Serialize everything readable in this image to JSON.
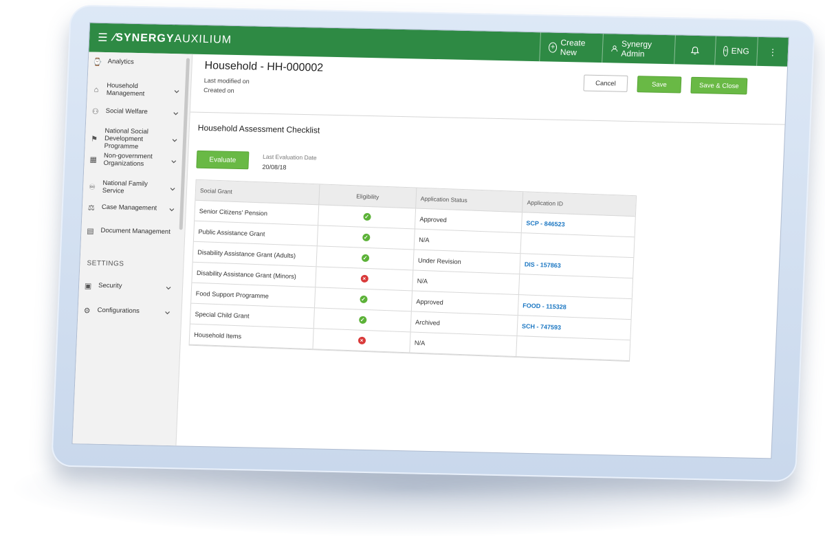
{
  "topbar": {
    "brand_main": "SYNERGY",
    "brand_sub": "AUXILIUM",
    "create_label": "Create New",
    "user_label": "Synergy Admin",
    "lang_label": "ENG"
  },
  "sidebar": {
    "items": [
      {
        "label": "Analytics",
        "icon": "chart-icon"
      },
      {
        "label": "Household Management",
        "icon": "home-icon"
      },
      {
        "label": "Social Welfare",
        "icon": "people-icon"
      },
      {
        "label": "National Social Development Programme",
        "icon": "bank-icon"
      },
      {
        "label": "Non-government Organizations",
        "icon": "building-icon"
      },
      {
        "label": "National Family Service",
        "icon": "family-icon"
      },
      {
        "label": "Case Management",
        "icon": "scales-icon"
      },
      {
        "label": "Document Management",
        "icon": "document-icon"
      }
    ],
    "settings_heading": "SETTINGS",
    "settings_items": [
      {
        "label": "Security",
        "icon": "lock-icon"
      },
      {
        "label": "Configurations",
        "icon": "gear-icon"
      }
    ]
  },
  "header": {
    "title": "Household - HH-000002",
    "last_modified": "Last modified on",
    "created_on": "Created on",
    "cancel_label": "Cancel",
    "save_label": "Save",
    "save_close_label": "Save & Close"
  },
  "checklist": {
    "title": "Household Assessment Checklist",
    "evaluate_label": "Evaluate",
    "last_eval_label": "Last Evaluation Date",
    "last_eval_date": "20/08/18",
    "columns": [
      "Social Grant",
      "Eligibility",
      "Application Status",
      "Application ID"
    ],
    "rows": [
      {
        "grant": "Senior Citizens' Pension",
        "eligible": true,
        "status": "Approved",
        "app_id": "SCP - 846523"
      },
      {
        "grant": "Public Assistance Grant",
        "eligible": true,
        "status": "N/A",
        "app_id": ""
      },
      {
        "grant": "Disability Assistance Grant (Adults)",
        "eligible": true,
        "status": "Under Revision",
        "app_id": "DIS - 157863"
      },
      {
        "grant": "Disability Assistance Grant (Minors)",
        "eligible": false,
        "status": "N/A",
        "app_id": ""
      },
      {
        "grant": "Food Support Programme",
        "eligible": true,
        "status": "Approved",
        "app_id": "FOOD - 115328"
      },
      {
        "grant": "Special Child Grant",
        "eligible": true,
        "status": "Archived",
        "app_id": "SCH - 747593"
      },
      {
        "grant": "Household Items",
        "eligible": false,
        "status": "N/A",
        "app_id": ""
      }
    ]
  },
  "colors": {
    "brand_green": "#2e8a44",
    "button_green": "#69b945",
    "check_green": "#5cb238",
    "cross_red": "#d93a3a",
    "link_blue": "#1a76c2"
  }
}
